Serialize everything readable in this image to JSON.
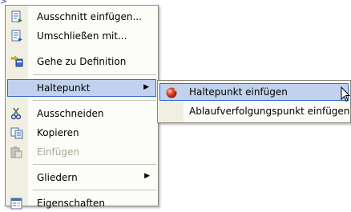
{
  "caret": ">",
  "main_menu": {
    "items": [
      {
        "label": "Ausschnitt einfügen...",
        "icon": "insert-snippet-icon"
      },
      {
        "label": "Umschließen mit...",
        "icon": "surround-with-icon"
      },
      {
        "label": "Gehe zu Definition",
        "icon": "go-to-definition-icon"
      },
      {
        "label": "Haltepunkt",
        "icon": "",
        "submenu": true,
        "selected": true
      },
      {
        "label": "Ausschneiden",
        "icon": "scissors-icon"
      },
      {
        "label": "Kopieren",
        "icon": "copy-icon"
      },
      {
        "label": "Einfügen",
        "icon": "paste-icon",
        "disabled": true
      },
      {
        "label": "Gliedern",
        "icon": "",
        "submenu": true
      },
      {
        "label": "Eigenschaften",
        "icon": "properties-icon"
      }
    ]
  },
  "sub_menu": {
    "items": [
      {
        "label": "Haltepunkt einfügen",
        "icon": "breakpoint-icon",
        "selected": true
      },
      {
        "label": "Ablaufverfolgungspunkt einfügen",
        "icon": ""
      }
    ]
  },
  "colors": {
    "selection_fill": "#c1d2ee",
    "selection_border": "#316ac5",
    "gutter": "#f1efe2",
    "disabled_text": "#a9a693"
  }
}
